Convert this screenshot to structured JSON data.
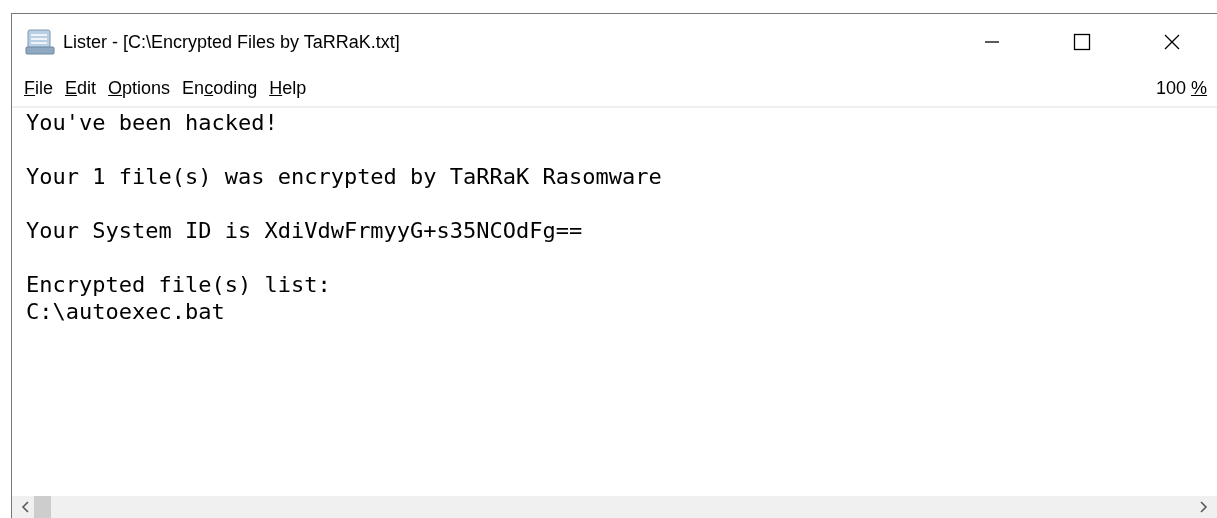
{
  "window": {
    "title": "Lister - [C:\\Encrypted Files by TaRRaK.txt]"
  },
  "menu": [
    {
      "key": "F",
      "after": "ile"
    },
    {
      "key": "E",
      "after": "dit"
    },
    {
      "key": "O",
      "after": "ptions"
    },
    {
      "before": "En",
      "key": "c",
      "after": "oding"
    },
    {
      "key": "H",
      "after": "elp"
    }
  ],
  "zoom": {
    "before": "100 ",
    "key": "%"
  },
  "paragraphs": [
    [
      "You've been hacked!"
    ],
    [
      "Your 1 file(s) was encrypted by TaRRaK Rasomware"
    ],
    [
      "Your System ID is XdiVdwFrmyyG+s35NCOdFg=="
    ],
    [
      "Encrypted file(s) list:",
      "C:\\autoexec.bat"
    ]
  ]
}
